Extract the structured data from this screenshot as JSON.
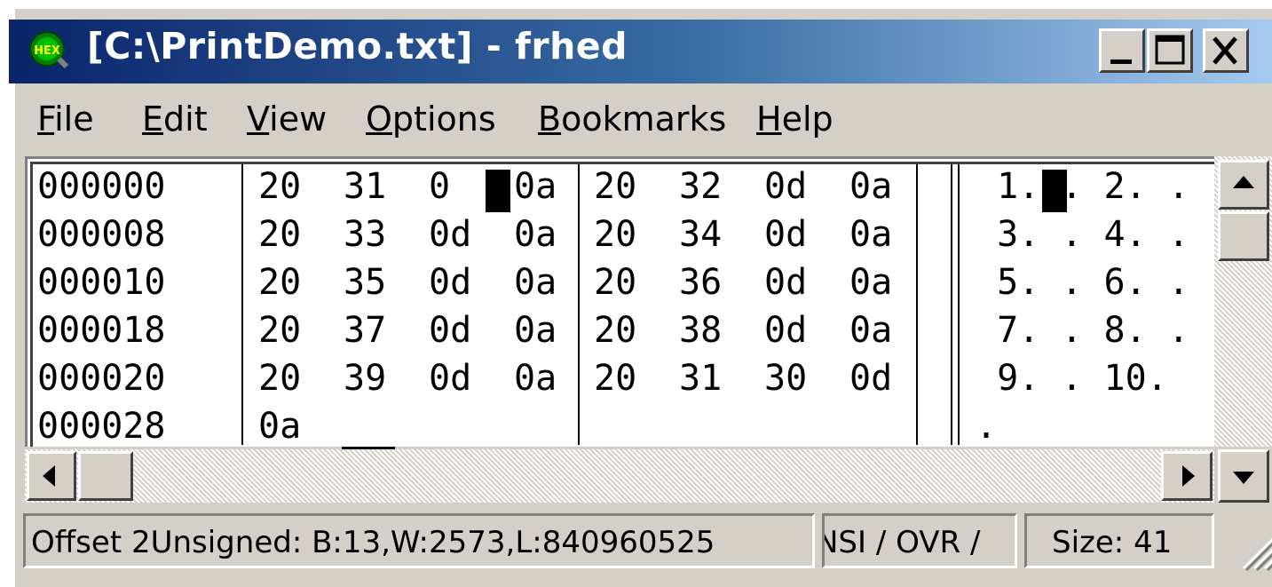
{
  "window": {
    "title": "[C:\\PrintDemo.txt] - frhed",
    "app_icon_label": "HEX",
    "buttons": {
      "minimize": "minimize",
      "maximize": "maximize",
      "close": "close"
    }
  },
  "menu": [
    {
      "label": "File",
      "mnemonic": "F",
      "rest": "ile"
    },
    {
      "label": "Edit",
      "mnemonic": "E",
      "rest": "dit"
    },
    {
      "label": "View",
      "mnemonic": "V",
      "rest": "iew"
    },
    {
      "label": "Options",
      "mnemonic": "O",
      "rest": "ptions"
    },
    {
      "label": "Bookmarks",
      "mnemonic": "B",
      "rest": "ookmarks"
    },
    {
      "label": "Help",
      "mnemonic": "H",
      "rest": "elp"
    }
  ],
  "hex_rows": [
    {
      "offset": "000000",
      "bytes": [
        "20",
        "31",
        "0d",
        "0a",
        "20",
        "32",
        "0d",
        "0a"
      ],
      "ascii": " 1. . 2. ."
    },
    {
      "offset": "000008",
      "bytes": [
        "20",
        "33",
        "0d",
        "0a",
        "20",
        "34",
        "0d",
        "0a"
      ],
      "ascii": " 3. . 4. ."
    },
    {
      "offset": "000010",
      "bytes": [
        "20",
        "35",
        "0d",
        "0a",
        "20",
        "36",
        "0d",
        "0a"
      ],
      "ascii": " 5. . 6. ."
    },
    {
      "offset": "000018",
      "bytes": [
        "20",
        "37",
        "0d",
        "0a",
        "20",
        "38",
        "0d",
        "0a"
      ],
      "ascii": " 7. . 8. ."
    },
    {
      "offset": "000020",
      "bytes": [
        "20",
        "39",
        "0d",
        "0a",
        "20",
        "31",
        "30",
        "0d"
      ],
      "ascii": " 9. . 10."
    },
    {
      "offset": "000028",
      "bytes": [
        "0a",
        "",
        "",
        "",
        "",
        "",
        "",
        ""
      ],
      "ascii": "."
    }
  ],
  "status": {
    "info": "Offset 2Unsigned: B:13,W:2573,L:840960525",
    "mode": "NSI / OVR /",
    "size": "Size: 41"
  },
  "colors": {
    "title_gradient_start": "#0a246a",
    "title_gradient_end": "#a6caf0",
    "face": "#d4d0c8"
  }
}
